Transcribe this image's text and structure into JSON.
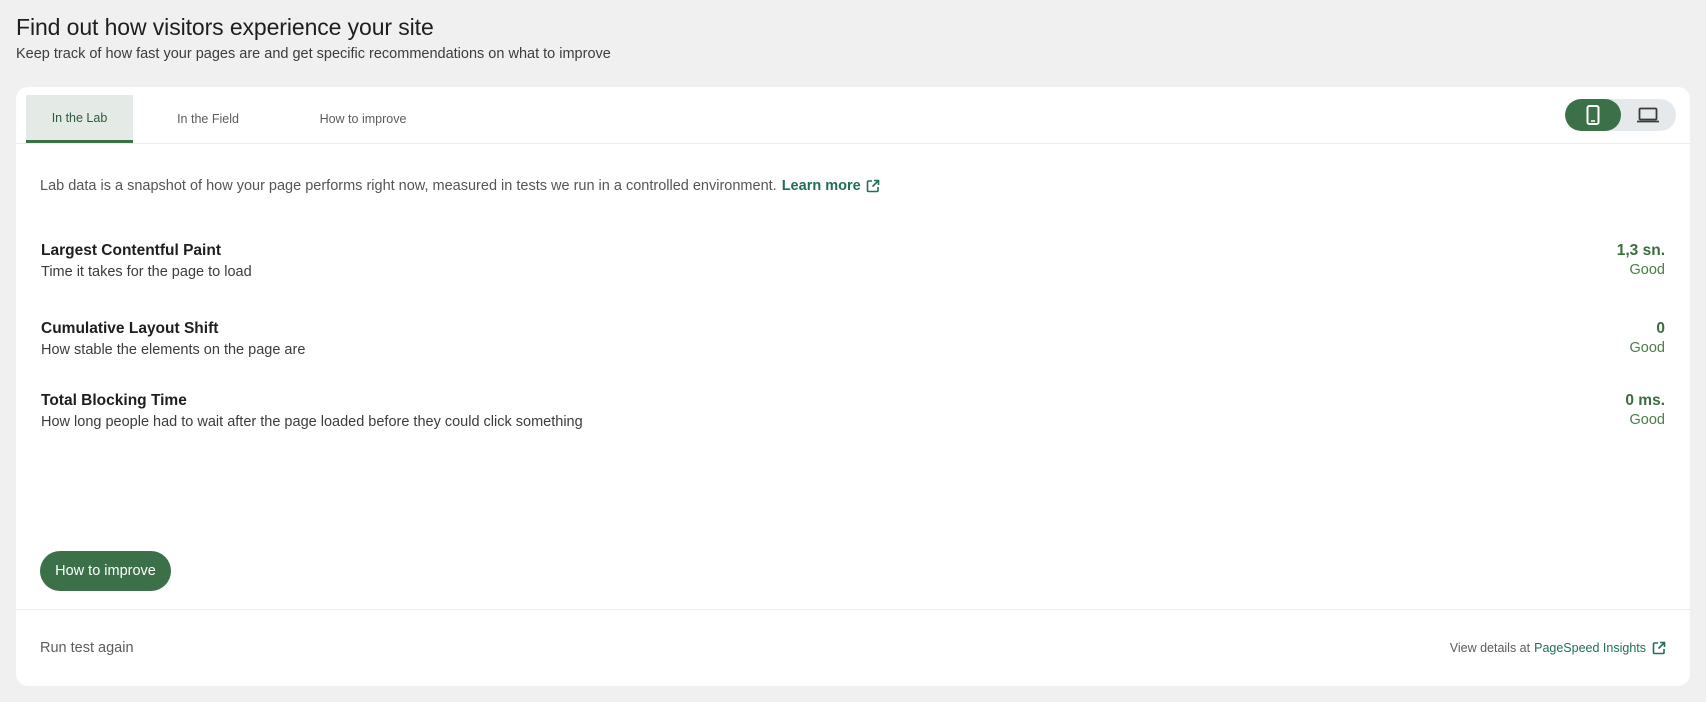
{
  "header": {
    "title": "Find out how visitors experience your site",
    "subtitle": "Keep track of how fast your pages are and get specific recommendations on what to improve"
  },
  "tabs": [
    {
      "label": "In the Lab",
      "active": true
    },
    {
      "label": "In the Field",
      "active": false
    },
    {
      "label": "How to improve",
      "active": false
    }
  ],
  "device_toggle": {
    "options": [
      {
        "icon": "smartphone-icon",
        "active": true
      },
      {
        "icon": "laptop-icon",
        "active": false
      }
    ]
  },
  "intro": {
    "text": "Lab data is a snapshot of how your page performs right now, measured in tests we run in a controlled environment.",
    "link_label": "Learn more",
    "link_icon": "external-link-icon"
  },
  "metrics": [
    {
      "name": "Largest Contentful Paint",
      "description": "Time it takes for the page to load",
      "value": "1,3 sn.",
      "status": "Good"
    },
    {
      "name": "Cumulative Layout Shift",
      "description": "How stable the elements on the page are",
      "value": "0",
      "status": "Good"
    },
    {
      "name": "Total Blocking Time",
      "description": "How long people had to wait after the page loaded before they could click something",
      "value": "0 ms.",
      "status": "Good"
    }
  ],
  "actions": {
    "improve_button": "How to improve",
    "run_again": "Run test again",
    "view_details_prefix": "View details at",
    "view_details_link": "PageSpeed Insights"
  },
  "colors": {
    "accent": "#3b7049",
    "good": "#4a7d46",
    "link": "#1f6f5c",
    "background": "#f0f0f0"
  }
}
